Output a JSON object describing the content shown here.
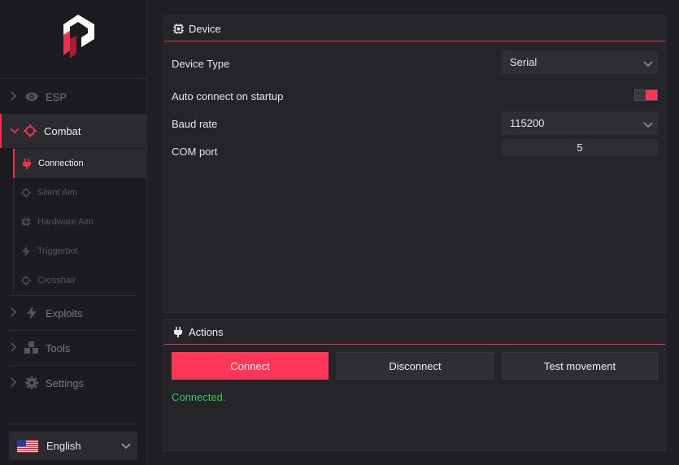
{
  "sidebar": {
    "items": [
      {
        "label": "ESP",
        "icon": "eye-icon"
      },
      {
        "label": "Combat",
        "icon": "crosshair-icon"
      },
      {
        "label": "Exploits",
        "icon": "bolt-icon"
      },
      {
        "label": "Tools",
        "icon": "cubes-icon"
      },
      {
        "label": "Settings",
        "icon": "gear-icon"
      }
    ],
    "sub_items": [
      {
        "label": "Connection",
        "icon": "plug-icon"
      },
      {
        "label": "Silent Aim",
        "icon": "crosshair-icon"
      },
      {
        "label": "Hardware Aim",
        "icon": "chip-icon"
      },
      {
        "label": "Triggerbot",
        "icon": "bolt-icon"
      },
      {
        "label": "Crosshair",
        "icon": "crosshair-icon"
      }
    ],
    "language": {
      "label": "English",
      "icon": "us-flag-icon"
    }
  },
  "device_panel": {
    "title": "Device",
    "device_type_label": "Device Type",
    "device_type_value": "Serial",
    "auto_connect_label": "Auto connect on startup",
    "auto_connect_on": true,
    "baud_rate_label": "Baud rate",
    "baud_rate_value": "115200",
    "com_port_label": "COM port",
    "com_port_value": "5"
  },
  "actions_panel": {
    "title": "Actions",
    "connect_label": "Connect",
    "disconnect_label": "Disconnect",
    "test_movement_label": "Test movement",
    "status_text": "Connected."
  },
  "colors": {
    "accent": "#ff3658",
    "accent_line": "#e8344e",
    "status_ok": "#42c15a",
    "background": "#1f1f23"
  }
}
